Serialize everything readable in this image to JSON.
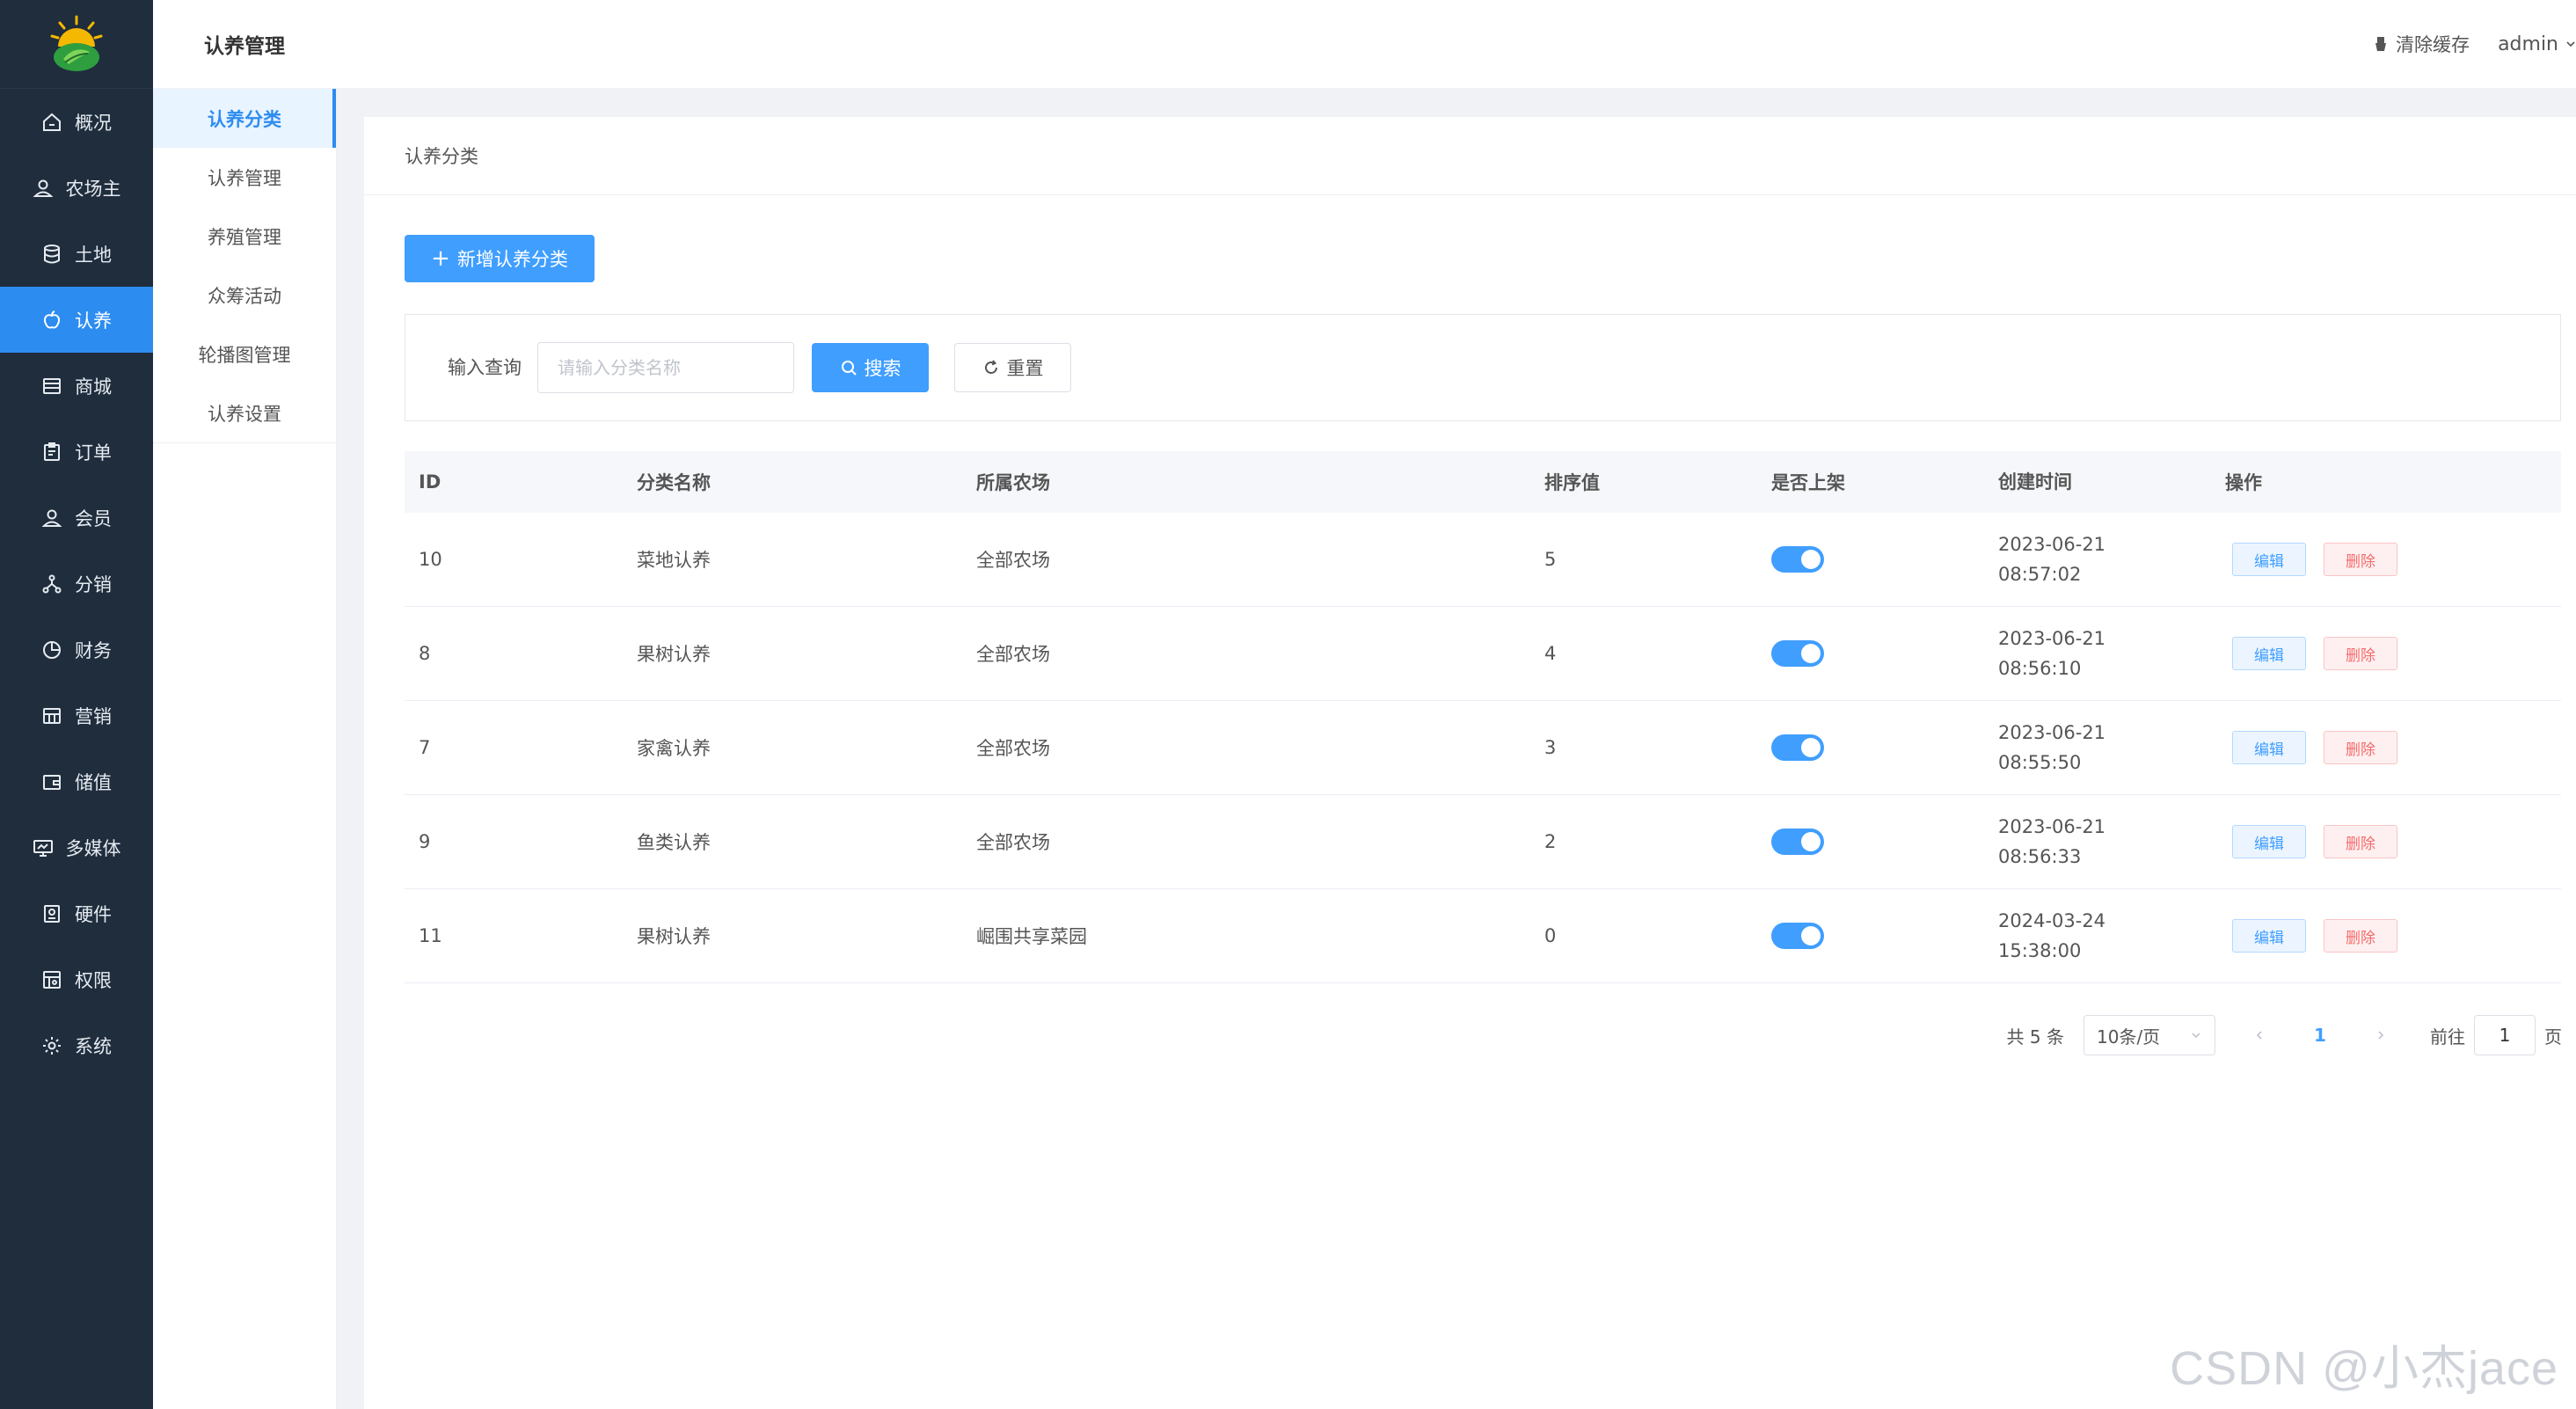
{
  "sidebar": {
    "items": [
      {
        "label": "概况",
        "icon": "home-icon"
      },
      {
        "label": "农场主",
        "icon": "user-icon"
      },
      {
        "label": "土地",
        "icon": "database-icon"
      },
      {
        "label": "认养",
        "icon": "apple-icon",
        "active": true
      },
      {
        "label": "商城",
        "icon": "store-icon"
      },
      {
        "label": "订单",
        "icon": "clipboard-icon"
      },
      {
        "label": "会员",
        "icon": "user-icon"
      },
      {
        "label": "分销",
        "icon": "network-icon"
      },
      {
        "label": "财务",
        "icon": "pie-chart-icon"
      },
      {
        "label": "营销",
        "icon": "gift-icon"
      },
      {
        "label": "储值",
        "icon": "wallet-icon"
      },
      {
        "label": "多媒体",
        "icon": "monitor-icon"
      },
      {
        "label": "硬件",
        "icon": "device-icon"
      },
      {
        "label": "权限",
        "icon": "lock-icon"
      },
      {
        "label": "系统",
        "icon": "gear-icon"
      }
    ]
  },
  "subnav": {
    "title": "认养管理",
    "items": [
      {
        "label": "认养分类",
        "active": true
      },
      {
        "label": "认养管理"
      },
      {
        "label": "养殖管理"
      },
      {
        "label": "众筹活动"
      },
      {
        "label": "轮播图管理"
      },
      {
        "label": "认养设置"
      }
    ]
  },
  "topbar": {
    "clear_cache": "清除缓存",
    "user": "admin"
  },
  "breadcrumb": "认养分类",
  "add_button": "新增认养分类",
  "search": {
    "label": "输入查询",
    "placeholder": "请输入分类名称",
    "value": "",
    "search_button": "搜索",
    "reset_button": "重置"
  },
  "table": {
    "columns": [
      "ID",
      "分类名称",
      "所属农场",
      "排序值",
      "是否上架",
      "创建时间",
      "操作"
    ],
    "rows": [
      {
        "id": "10",
        "name": "菜地认养",
        "farm": "全部农场",
        "sort": "5",
        "on_shelf": true,
        "date": "2023-06-21",
        "time": "08:57:02"
      },
      {
        "id": "8",
        "name": "果树认养",
        "farm": "全部农场",
        "sort": "4",
        "on_shelf": true,
        "date": "2023-06-21",
        "time": "08:56:10"
      },
      {
        "id": "7",
        "name": "家禽认养",
        "farm": "全部农场",
        "sort": "3",
        "on_shelf": true,
        "date": "2023-06-21",
        "time": "08:55:50"
      },
      {
        "id": "9",
        "name": "鱼类认养",
        "farm": "全部农场",
        "sort": "2",
        "on_shelf": true,
        "date": "2023-06-21",
        "time": "08:56:33"
      },
      {
        "id": "11",
        "name": "果树认养",
        "farm": "崛围共享菜园",
        "sort": "0",
        "on_shelf": true,
        "date": "2024-03-24",
        "time": "15:38:00"
      }
    ],
    "edit_label": "编辑",
    "delete_label": "删除"
  },
  "pagination": {
    "total": "共 5 条",
    "page_size": "10条/页",
    "current_page": "1",
    "goto_prefix": "前往",
    "goto_value": "1",
    "goto_suffix": "页"
  },
  "watermark": "CSDN @小杰jace",
  "colors": {
    "sidebar_bg": "#1f2d3d",
    "accent": "#409eff",
    "active_nav": "#2d8cf0",
    "danger": "#f56c6c"
  }
}
